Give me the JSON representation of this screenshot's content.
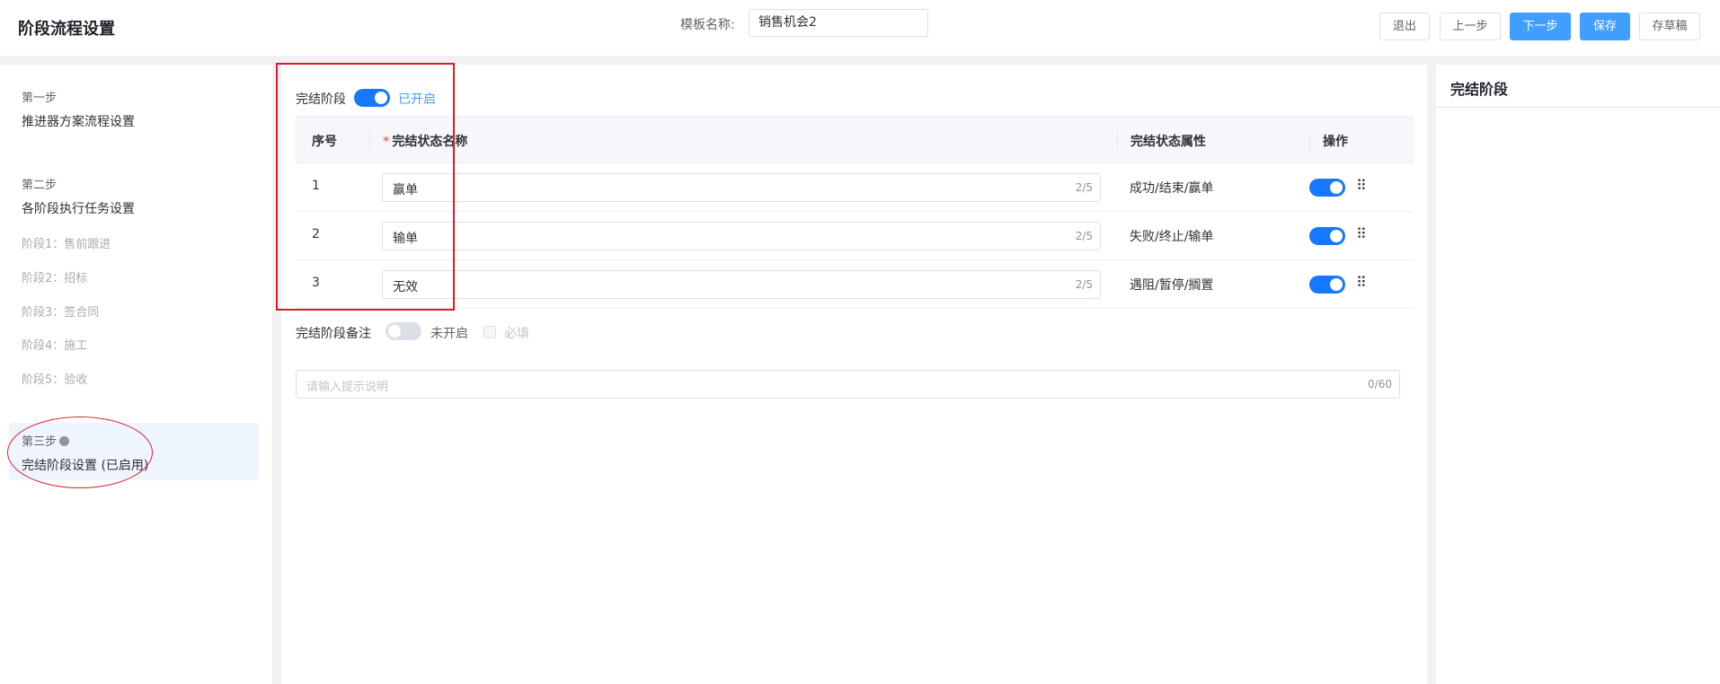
{
  "header": {
    "title": "阶段流程设置",
    "template_label": "模板名称:",
    "template_name": "销售机会2",
    "buttons": {
      "exit": "退出",
      "prev": "上一步",
      "next": "下一步",
      "save": "保存",
      "draft": "存草稿"
    }
  },
  "sidebar": {
    "step1": {
      "label": "第一步",
      "title": "推进器方案流程设置"
    },
    "step2": {
      "label": "第二步",
      "title": "各阶段执行任务设置"
    },
    "stages": [
      "阶段1：售前跟进",
      "阶段2：招标",
      "阶段3：签合同",
      "阶段4：施工",
      "阶段5：验收"
    ],
    "step3": {
      "label": "第三步",
      "title": "完结阶段设置 (已启用)"
    }
  },
  "main": {
    "section_label": "完结阶段",
    "section_enabled": true,
    "section_status": "已开启",
    "columns": {
      "no": "序号",
      "name": "完结状态名称",
      "attr": "完结状态属性",
      "op": "操作"
    },
    "rows": [
      {
        "no": "1",
        "name": "赢单",
        "count": "2/5",
        "attr": "成功/结束/赢单",
        "enabled": true
      },
      {
        "no": "2",
        "name": "输单",
        "count": "2/5",
        "attr": "失败/终止/输单",
        "enabled": true
      },
      {
        "no": "3",
        "name": "无效",
        "count": "2/5",
        "attr": "遇阻/暂停/搁置",
        "enabled": true
      }
    ],
    "remark_label": "完结阶段备注",
    "remark_enabled": false,
    "remark_status": "未开启",
    "required_label": "必填",
    "hint_placeholder": "请输入提示说明",
    "hint_count": "0/60"
  },
  "right_panel": {
    "title": "完结阶段"
  },
  "colors": {
    "primary": "#409eff",
    "toggle_on": "#1677ff",
    "annotation_red": "#e01b24"
  }
}
